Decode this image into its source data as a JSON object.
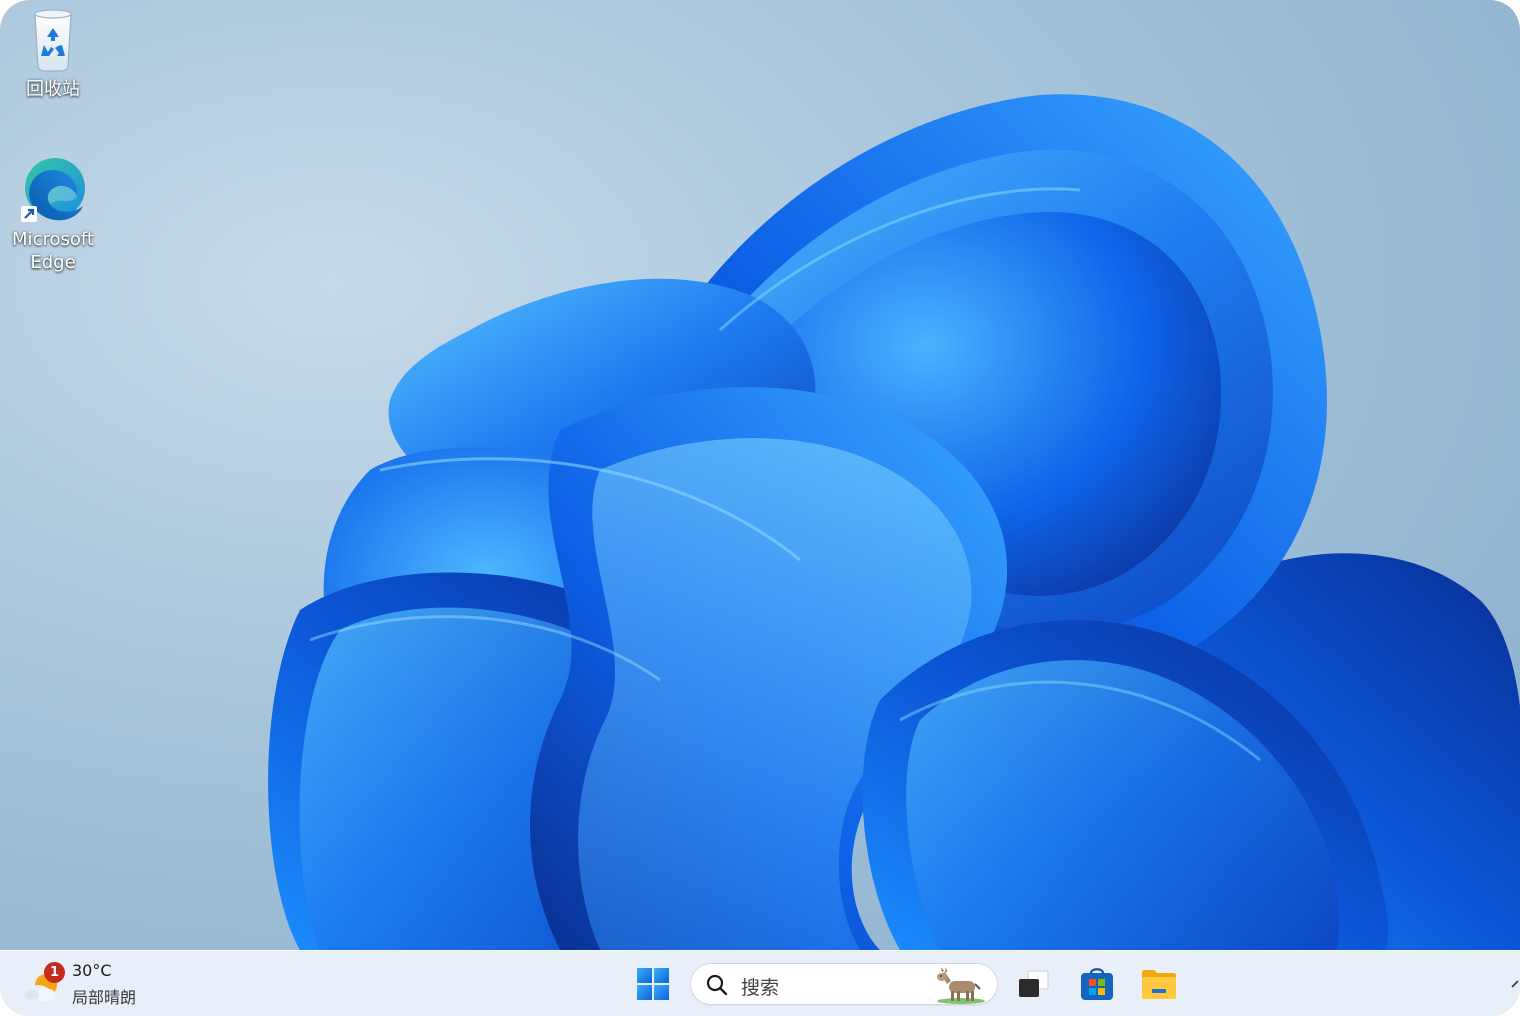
{
  "desktop": {
    "icons": [
      {
        "label": "回收站",
        "icon": "recycle-bin-icon"
      },
      {
        "label": "Microsoft\nEdge",
        "icon": "edge-icon"
      }
    ]
  },
  "taskbar": {
    "weather": {
      "temperature": "30°C",
      "condition": "局部晴朗",
      "badge": "1",
      "icon": "partly-sunny-icon"
    },
    "start": {
      "icon": "windows-logo-icon"
    },
    "search": {
      "placeholder": "搜索",
      "icon": "search-icon",
      "highlight_icon": "donkey-icon"
    },
    "pinned": [
      {
        "icon": "task-view-icon"
      },
      {
        "icon": "microsoft-store-icon"
      },
      {
        "icon": "file-explorer-icon"
      }
    ]
  },
  "colors": {
    "accent": "#0a5fe0",
    "taskbar": "#ebf1fa",
    "badge": "#c42b1c",
    "folder": "#f5c13c"
  }
}
